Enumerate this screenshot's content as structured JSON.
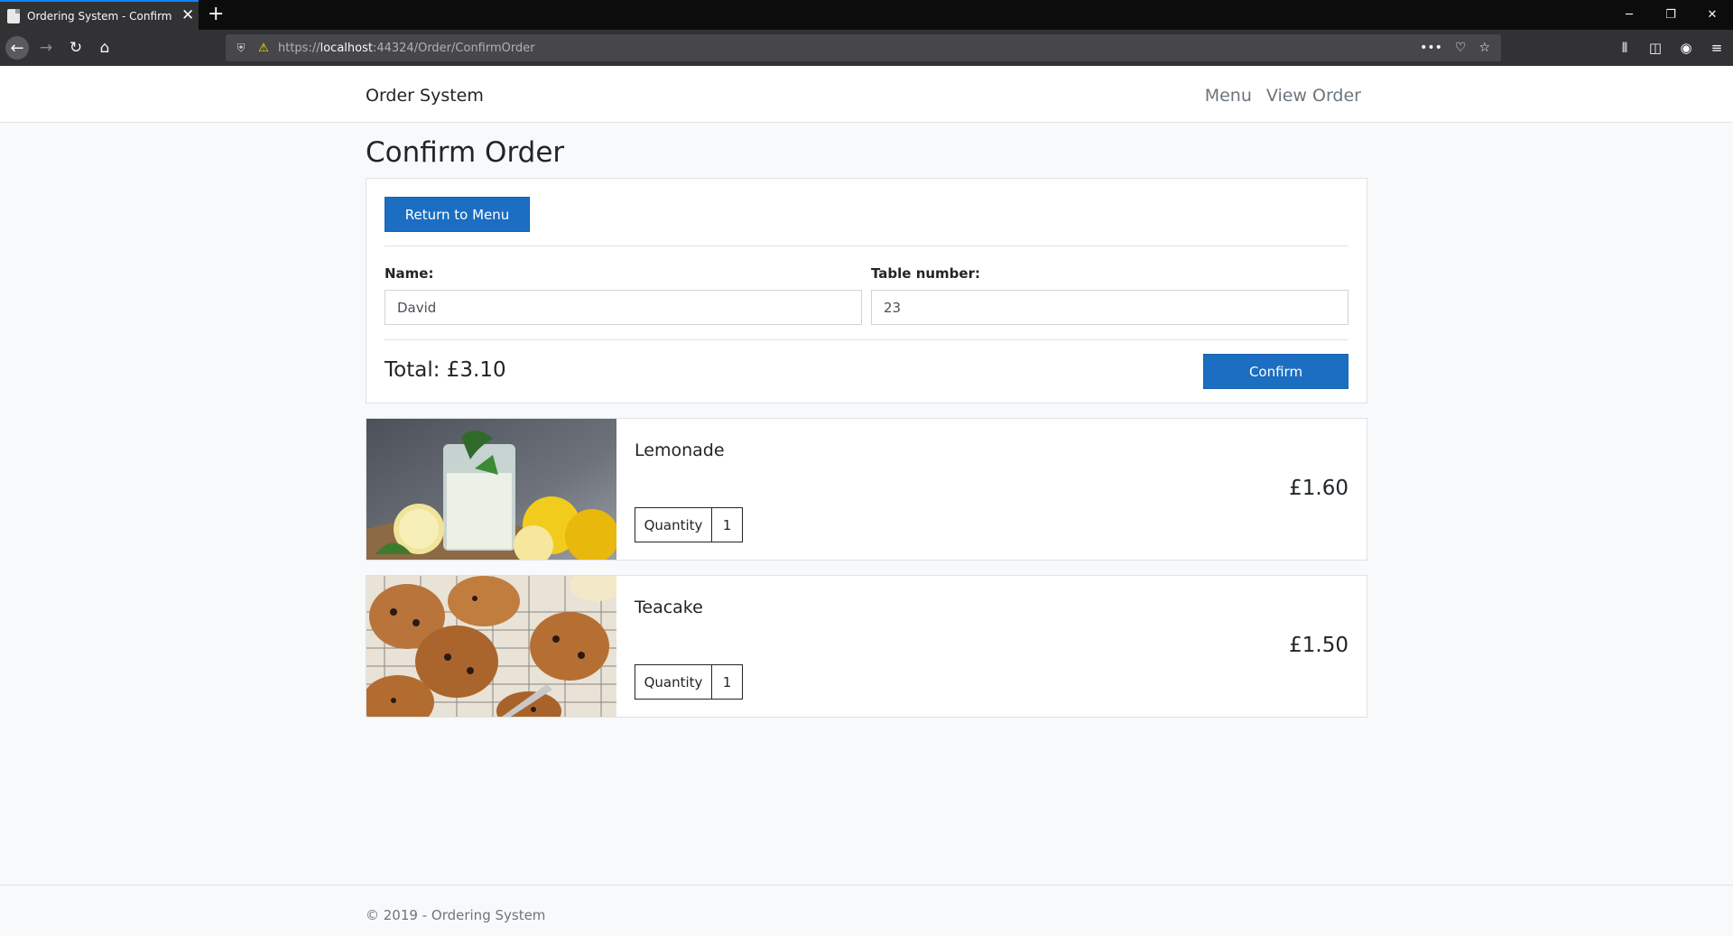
{
  "browser": {
    "tab_title": "Ordering System - Confirm Order",
    "url_prefix": "https://",
    "url_host": "localhost",
    "url_rest": ":44324/Order/ConfirmOrder"
  },
  "header": {
    "brand": "Order System",
    "nav": {
      "menu": "Menu",
      "view_order": "View Order"
    }
  },
  "page": {
    "title": "Confirm Order",
    "return_button": "Return to Menu",
    "name_label": "Name:",
    "name_value": "David",
    "table_label": "Table number:",
    "table_value": "23",
    "total": "Total: £3.10",
    "confirm_button": "Confirm"
  },
  "items": [
    {
      "name": "Lemonade",
      "price": "£1.60",
      "quantity_label": "Quantity",
      "quantity": "1"
    },
    {
      "name": "Teacake",
      "price": "£1.50",
      "quantity_label": "Quantity",
      "quantity": "1"
    }
  ],
  "footer": {
    "text": "© 2019 - Ordering System"
  },
  "colors": {
    "primary": "#1b6ec2",
    "background": "#f8f9fa",
    "border": "#dee2e6"
  }
}
